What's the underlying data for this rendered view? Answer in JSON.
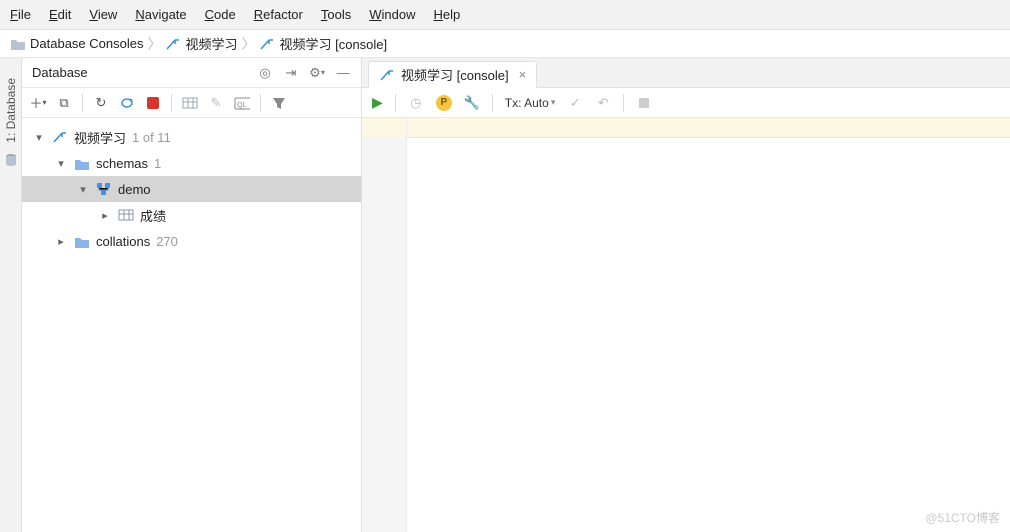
{
  "menu": {
    "file": "File",
    "edit": "Edit",
    "view": "View",
    "navigate": "Navigate",
    "code": "Code",
    "refactor": "Refactor",
    "tools": "Tools",
    "window": "Window",
    "help": "Help"
  },
  "breadcrumb": {
    "root": "Database Consoles",
    "mid": "视频学习",
    "leaf": "视频学习 [console]"
  },
  "leftbar": {
    "label": "1: Database"
  },
  "panel": {
    "title": "Database",
    "tree": {
      "root": {
        "name": "视频学习",
        "count": "1 of 11"
      },
      "schemas": {
        "name": "schemas",
        "count": "1"
      },
      "demo": {
        "name": "demo"
      },
      "table1": {
        "name": "成绩"
      },
      "collations": {
        "name": "collations",
        "count": "270"
      }
    }
  },
  "editor": {
    "tab": "视频学习 [console]",
    "tx": "Tx: Auto"
  },
  "watermark": "@51CTO博客"
}
